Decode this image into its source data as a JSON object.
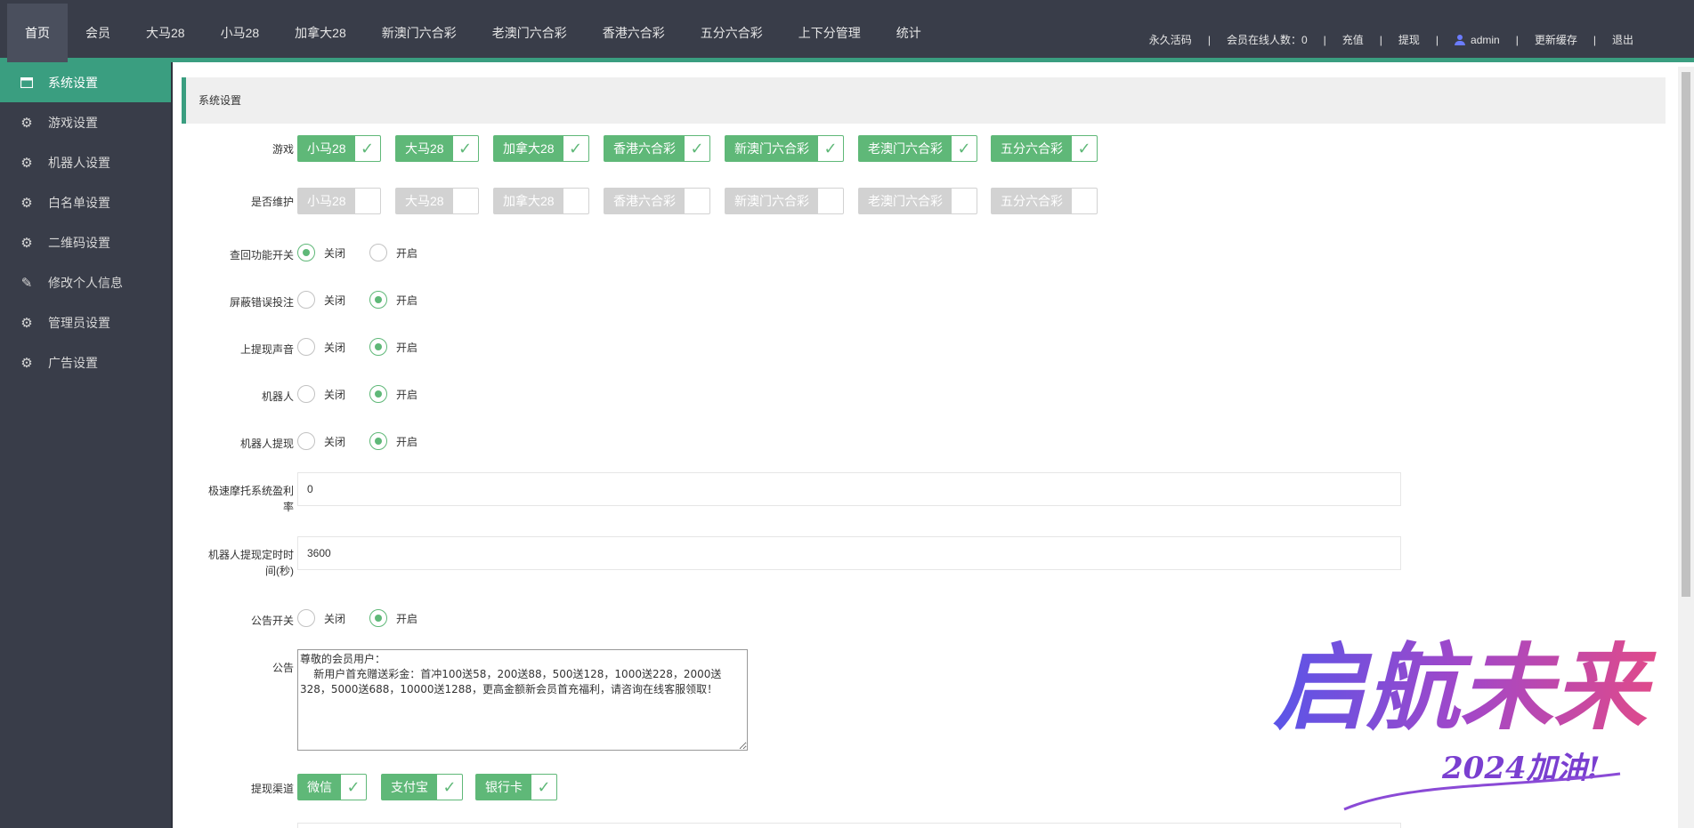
{
  "topnav": {
    "items": [
      "首页",
      "会员",
      "大马28",
      "小马28",
      "加拿大28",
      "新澳门六合彩",
      "老澳门六合彩",
      "香港六合彩",
      "五分六合彩",
      "上下分管理",
      "统计"
    ]
  },
  "toplinks": {
    "permanent_code": "永久活码",
    "online_label": "会员在线人数：0",
    "recharge": "充值",
    "withdraw": "提现",
    "user": "admin",
    "refresh_cache": "更新缓存",
    "logout": "退出"
  },
  "sidebar": {
    "items": [
      {
        "label": "系统设置",
        "icon": "window-icon"
      },
      {
        "label": "游戏设置",
        "icon": "gear-icon"
      },
      {
        "label": "机器人设置",
        "icon": "gear-icon"
      },
      {
        "label": "白名单设置",
        "icon": "gear-icon"
      },
      {
        "label": "二维码设置",
        "icon": "gear-icon"
      },
      {
        "label": "修改个人信息",
        "icon": "pencil-icon"
      },
      {
        "label": "管理员设置",
        "icon": "gear-icon"
      },
      {
        "label": "广告设置",
        "icon": "gear-icon"
      }
    ]
  },
  "panel_title": "系统设置",
  "form": {
    "games_label": "游戏",
    "games": [
      {
        "label": "小马28",
        "checked": true
      },
      {
        "label": "大马28",
        "checked": true
      },
      {
        "label": "加拿大28",
        "checked": true
      },
      {
        "label": "香港六合彩",
        "checked": true
      },
      {
        "label": "新澳门六合彩",
        "checked": true
      },
      {
        "label": "老澳门六合彩",
        "checked": true
      },
      {
        "label": "五分六合彩",
        "checked": true
      }
    ],
    "maintenance_label": "是否维护",
    "maintenance": [
      {
        "label": "小马28",
        "checked": false
      },
      {
        "label": "大马28",
        "checked": false
      },
      {
        "label": "加拿大28",
        "checked": false
      },
      {
        "label": "香港六合彩",
        "checked": false
      },
      {
        "label": "新澳门六合彩",
        "checked": false
      },
      {
        "label": "老澳门六合彩",
        "checked": false
      },
      {
        "label": "五分六合彩",
        "checked": false
      }
    ],
    "off_label": "关闭",
    "on_label": "开启",
    "radios": [
      {
        "label": "查回功能开关",
        "value": "off"
      },
      {
        "label": "屏蔽错误投注",
        "value": "on"
      },
      {
        "label": "上提现声音",
        "value": "on"
      },
      {
        "label": "机器人",
        "value": "on"
      },
      {
        "label": "机器人提现",
        "value": "on"
      }
    ],
    "profit_rate_label_1": "极速摩托系统盈利",
    "profit_rate_label_2": "率",
    "profit_rate_value": "0",
    "robot_timer_label_1": "机器人提现定时时",
    "robot_timer_label_2": "间(秒)",
    "robot_timer_value": "3600",
    "notice_switch_label": "公告开关",
    "notice_switch_value": "on",
    "notice_label": "公告",
    "notice_text": "尊敬的会员用户：\n    新用户首充赠送彩金：首冲100送58，200送88，500送128，1000送228，2000送328，5000送688，10000送1288，更高金额新会员首充福利，请咨询在线客服领取！",
    "withdraw_channels_label": "提现渠道",
    "withdraw_channels": [
      {
        "label": "微信",
        "checked": true
      },
      {
        "label": "支付宝",
        "checked": true
      },
      {
        "label": "银行卡",
        "checked": true
      }
    ]
  },
  "watermark": {
    "title": "启航未来",
    "subtitle": "2024加油!"
  },
  "colors": {
    "topbar": "#393D49",
    "accent": "#3a9e80",
    "green": "#5FB878"
  }
}
